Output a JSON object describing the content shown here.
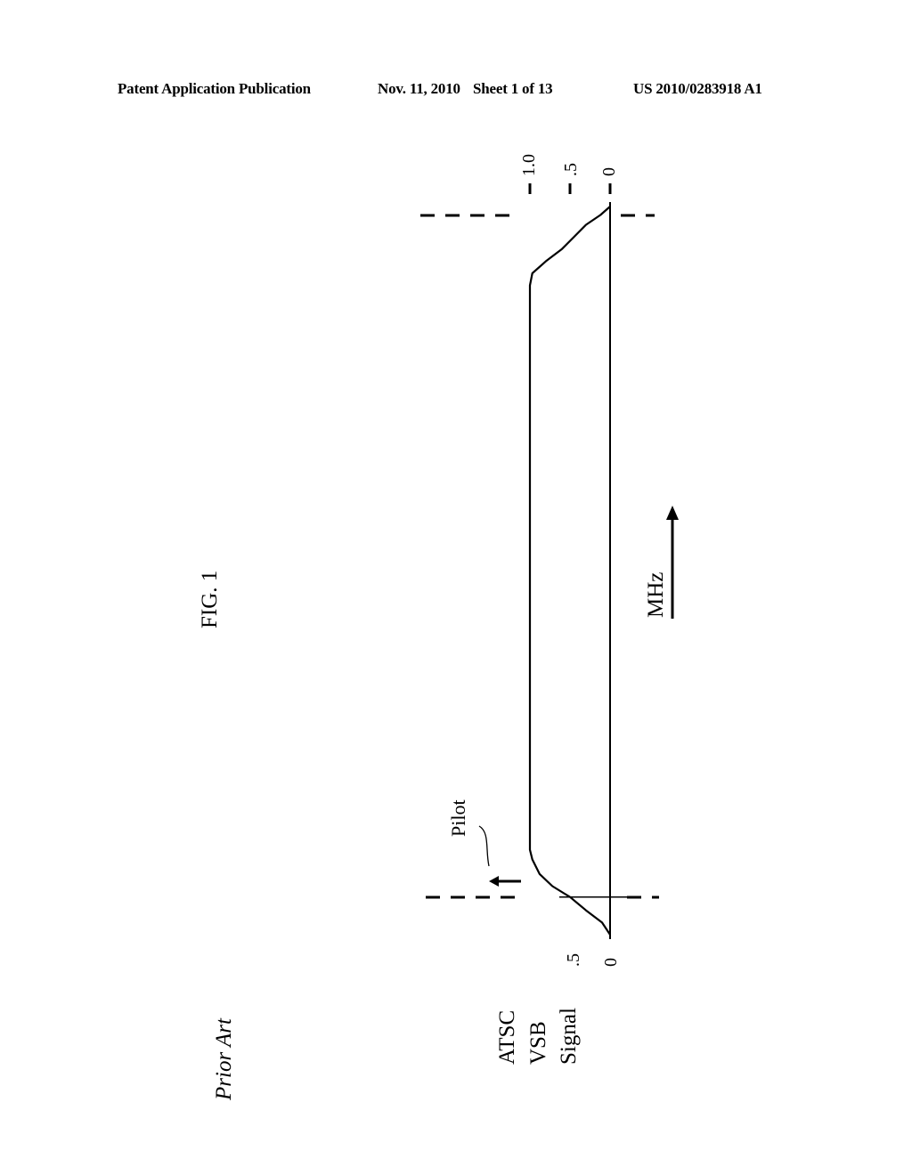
{
  "header": {
    "publication": "Patent Application Publication",
    "date": "Nov. 11, 2010",
    "sheet": "Sheet 1 of 13",
    "number": "US 2010/0283918 A1"
  },
  "figure": {
    "label": "FIG. 1",
    "caption": "Prior Art",
    "signal_label_lines": [
      "ATSC",
      "VSB",
      "Signal"
    ],
    "axis_label": "MHz",
    "annotation": "Pilot"
  },
  "chart_data": {
    "type": "line",
    "orientation": "rotated-90-ccw",
    "title": "FIG. 1",
    "xlabel": "MHz",
    "ylabel": "ATSC VSB Signal",
    "xlim": [
      0,
      6
    ],
    "ylim": [
      0,
      1.0
    ],
    "top_ticks": [
      "1.0",
      ".5",
      "0"
    ],
    "bottom_ticks": [
      ".5",
      "0"
    ],
    "top_tick_values": [
      1.0,
      0.5,
      0
    ],
    "bottom_tick_values": [
      0.5,
      0
    ],
    "series": [
      {
        "name": "ATSC VSB Signal",
        "x": [
          0.0,
          0.1,
          0.2,
          0.31,
          0.4,
          0.5,
          0.62,
          0.7,
          5.35,
          5.45,
          5.55,
          5.65,
          5.75,
          5.85,
          5.93,
          6.0
        ],
        "y": [
          0.0,
          0.1,
          0.3,
          0.5,
          0.72,
          0.88,
          0.97,
          1.0,
          1.0,
          0.97,
          0.8,
          0.6,
          0.45,
          0.3,
          0.12,
          0.0
        ]
      }
    ],
    "pilot": {
      "x": 0.31,
      "y": 0.5
    },
    "band_edges": [
      0.31,
      5.69
    ],
    "grid": false,
    "legend": "none"
  }
}
